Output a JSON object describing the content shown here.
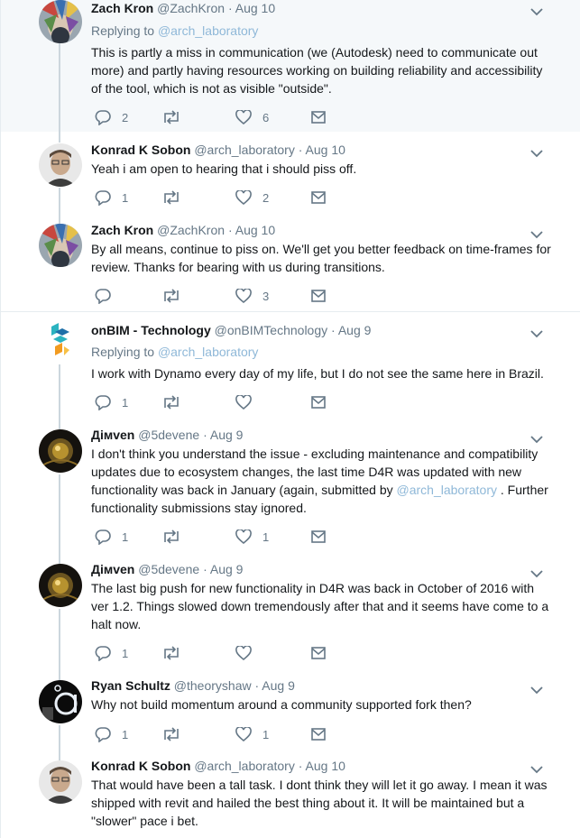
{
  "tweets": [
    {
      "name": "Zach Kron",
      "handle": "@ZachKron",
      "date": "Aug 10",
      "replying_prefix": "Replying to ",
      "replying_to": "@arch_laboratory",
      "text": "This is partly a miss in communication (we (Autodesk) need to communicate out more) and partly having resources working on building reliability and accessibility of the tool, which is not as visible \"outside\".",
      "replies": "2",
      "retweets": "",
      "likes": "6",
      "avatar": "zach-avatar"
    },
    {
      "name": "Konrad K Sobon",
      "handle": "@arch_laboratory",
      "date": "Aug 10",
      "text": "Yeah i am open to hearing that i should piss off.",
      "replies": "1",
      "retweets": "",
      "likes": "2",
      "avatar": "konrad-avatar"
    },
    {
      "name": "Zach Kron",
      "handle": "@ZachKron",
      "date": "Aug 10",
      "text": "By all means, continue to piss on.  We'll get you better feedback on time-frames for review.  Thanks for bearing with us during transitions.",
      "replies": "",
      "retweets": "",
      "likes": "3",
      "avatar": "zach-avatar"
    },
    {
      "name": "onBIM - Technology",
      "handle": "@onBIMTechnology",
      "date": "Aug 9",
      "replying_prefix": "Replying to ",
      "replying_to": "@arch_laboratory",
      "text": "I work with Dynamo every day of my life, but I do not see the same here in Brazil.",
      "replies": "1",
      "retweets": "",
      "likes": "",
      "avatar": "onbim-logo"
    },
    {
      "name": "Дімven",
      "handle": "@5devene",
      "date": "Aug 9",
      "text_before": "I don't think you understand the issue - excluding maintenance and compatibility updates due to ecosystem changes, the last time D4R was updated with new functionality was back in January (again, submitted by ",
      "text_mention": "@arch_laboratory",
      "text_after": " . Further functionality submissions stay ignored.",
      "replies": "1",
      "retweets": "",
      "likes": "1",
      "avatar": "dimven-avatar"
    },
    {
      "name": "Дімven",
      "handle": "@5devene",
      "date": "Aug 9",
      "text": "The last big push for new functionality in D4R was back in October of 2016 with ver 1.2. Things slowed down tremendously after that and it seems have come to a halt now.",
      "replies": "1",
      "retweets": "",
      "likes": "",
      "avatar": "dimven-avatar"
    },
    {
      "name": "Ryan Schultz",
      "handle": "@theoryshaw",
      "date": "Aug 9",
      "text": "Why not build momentum around a community supported fork then?",
      "replies": "1",
      "retweets": "",
      "likes": "1",
      "avatar": "ryan-avatar"
    },
    {
      "name": "Konrad K Sobon",
      "handle": "@arch_laboratory",
      "date": "Aug 10",
      "text": "That would have been a tall task. I dont think they will let it go away. I mean it was shipped with revit and hailed the best thing about it. It will be maintained but a \"slower\" pace i bet.",
      "avatar": "konrad-avatar"
    }
  ],
  "separator_dot": "·",
  "colors": {
    "name": "#14171a",
    "secondary": "#657786",
    "mention": "#8fb8d8",
    "highlight_bg": "#f5f8fa",
    "thread_line": "#ccd6dd"
  }
}
